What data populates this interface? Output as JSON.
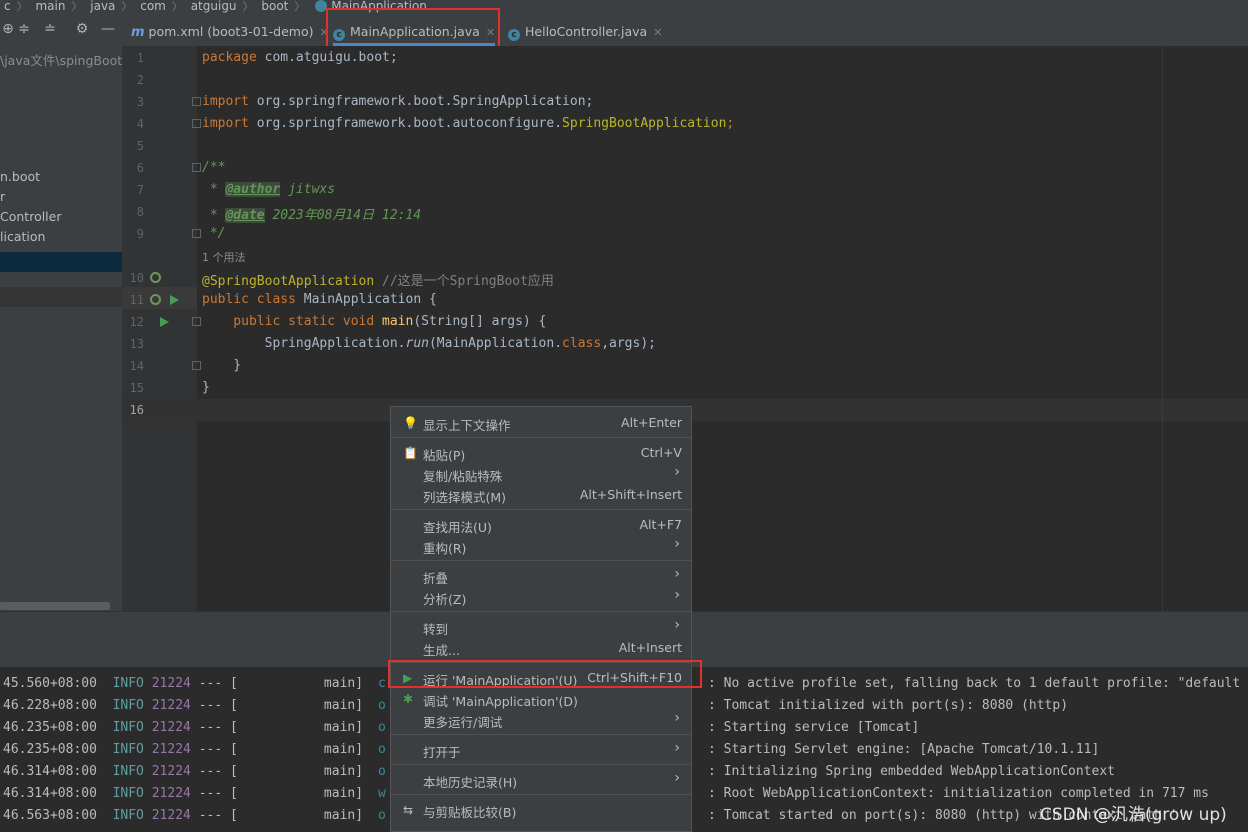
{
  "breadcrumb": [
    "c",
    "main",
    "java",
    "com",
    "atguigu",
    "boot",
    "MainApplication"
  ],
  "tabs": [
    {
      "label": "pom.xml (boot3-01-demo)",
      "icon": "maven-icon"
    },
    {
      "label": "MainApplication.java",
      "icon": "class-icon"
    },
    {
      "label": "HelloController.java",
      "icon": "class-icon"
    }
  ],
  "project": {
    "items": [
      "\\java文件\\spingBoot-",
      "n.boot",
      "r",
      "Controller",
      "lication"
    ]
  },
  "editor": {
    "line_numbers": [
      "1",
      "2",
      "3",
      "4",
      "5",
      "6",
      "7",
      "8",
      "9",
      "10",
      "11",
      "12",
      "13",
      "14",
      "15",
      "16"
    ],
    "usages_hint": "1 个用法",
    "lines": {
      "l1_kw": "package",
      "l1_rest": " com.atguigu.boot;",
      "l3_kw": "import",
      "l3_rest": " org.springframework.boot.SpringApplication;",
      "l4_kw": "import",
      "l4_rest": " org.springframework.boot.autoconfigure.",
      "l4_cls": "SpringBootApplication",
      "l4_end": ";",
      "l6": "/**",
      "l7_pre": " * ",
      "l7_tag": "@author",
      "l7_val": " jitwxs",
      "l8_pre": " * ",
      "l8_tag": "@date",
      "l8_val": " 2023年08月14日 12:14",
      "l9": " */",
      "l10_ann": "@SpringBootApplication",
      "l10_cm": " //这是一个SpringBoot应用",
      "l11_kw": "public class",
      "l11_rest": " MainApplication {",
      "l12_kw": "    public static void",
      "l12_fn": " main",
      "l12_rest": "(String[] args) {",
      "l13_pre": "        SpringApplication.",
      "l13_run": "run",
      "l13_mid": "(MainApplication.",
      "l13_kw": "class",
      "l13_end": ",args);",
      "l14": "    }",
      "l15": "}"
    }
  },
  "console": {
    "lines": [
      {
        "time": "45.560+08:00",
        "level": "INFO",
        "pid": "21224",
        "sep": "--- [",
        "thread": "main]",
        "logger": "c",
        "msg": ": No active profile set, falling back to 1 default profile: \"default"
      },
      {
        "time": "46.228+08:00",
        "level": "INFO",
        "pid": "21224",
        "sep": "--- [",
        "thread": "main]",
        "logger": "o",
        "msg": ": Tomcat initialized with port(s): 8080 (http)"
      },
      {
        "time": "46.235+08:00",
        "level": "INFO",
        "pid": "21224",
        "sep": "--- [",
        "thread": "main]",
        "logger": "o",
        "msg": ": Starting service [Tomcat]"
      },
      {
        "time": "46.235+08:00",
        "level": "INFO",
        "pid": "21224",
        "sep": "--- [",
        "thread": "main]",
        "logger": "o",
        "msg": ": Starting Servlet engine: [Apache Tomcat/10.1.11]"
      },
      {
        "time": "46.314+08:00",
        "level": "INFO",
        "pid": "21224",
        "sep": "--- [",
        "thread": "main]",
        "logger": "o",
        "msg": ": Initializing Spring embedded WebApplicationContext"
      },
      {
        "time": "46.314+08:00",
        "level": "INFO",
        "pid": "21224",
        "sep": "--- [",
        "thread": "main]",
        "logger": "w",
        "msg": ": Root WebApplicationContext: initialization completed in 717 ms"
      },
      {
        "time": "46.563+08:00",
        "level": "INFO",
        "pid": "21224",
        "sep": "--- [",
        "thread": "main]",
        "logger": "o",
        "msg": ": Tomcat started on port(s): 8080 (http) with context path ''"
      }
    ]
  },
  "context_menu": {
    "items": [
      {
        "label": "显示上下文操作",
        "shortcut": "Alt+Enter",
        "icon": "bulb-icon"
      },
      {
        "label": "粘贴(P)",
        "shortcut": "Ctrl+V",
        "icon": "clipboard-icon"
      },
      {
        "label": "复制/粘贴特殊",
        "shortcut": "",
        "submenu": true
      },
      {
        "label": "列选择模式(M)",
        "shortcut": "Alt+Shift+Insert"
      },
      {
        "label": "查找用法(U)",
        "shortcut": "Alt+F7"
      },
      {
        "label": "重构(R)",
        "shortcut": "",
        "submenu": true
      },
      {
        "label": "折叠",
        "shortcut": "",
        "submenu": true
      },
      {
        "label": "分析(Z)",
        "shortcut": "",
        "submenu": true
      },
      {
        "label": "转到",
        "shortcut": "",
        "submenu": true
      },
      {
        "label": "生成...",
        "shortcut": "Alt+Insert"
      },
      {
        "label": "运行 'MainApplication'(U)",
        "shortcut": "Ctrl+Shift+F10",
        "icon": "run-icon"
      },
      {
        "label": "调试 'MainApplication'(D)",
        "shortcut": "",
        "icon": "debug-icon"
      },
      {
        "label": "更多运行/调试",
        "shortcut": "",
        "submenu": true
      },
      {
        "label": "打开于",
        "shortcut": "",
        "submenu": true
      },
      {
        "label": "本地历史记录(H)",
        "shortcut": "",
        "submenu": true
      },
      {
        "label": "与剪贴板比较(B)",
        "shortcut": "",
        "icon": "compare-icon"
      }
    ]
  },
  "watermark": "CSDN @汎浩(grow up)",
  "colors": {
    "accent": "#4a88c7",
    "highlight_box": "#e0312a",
    "run_green": "#499c54"
  }
}
